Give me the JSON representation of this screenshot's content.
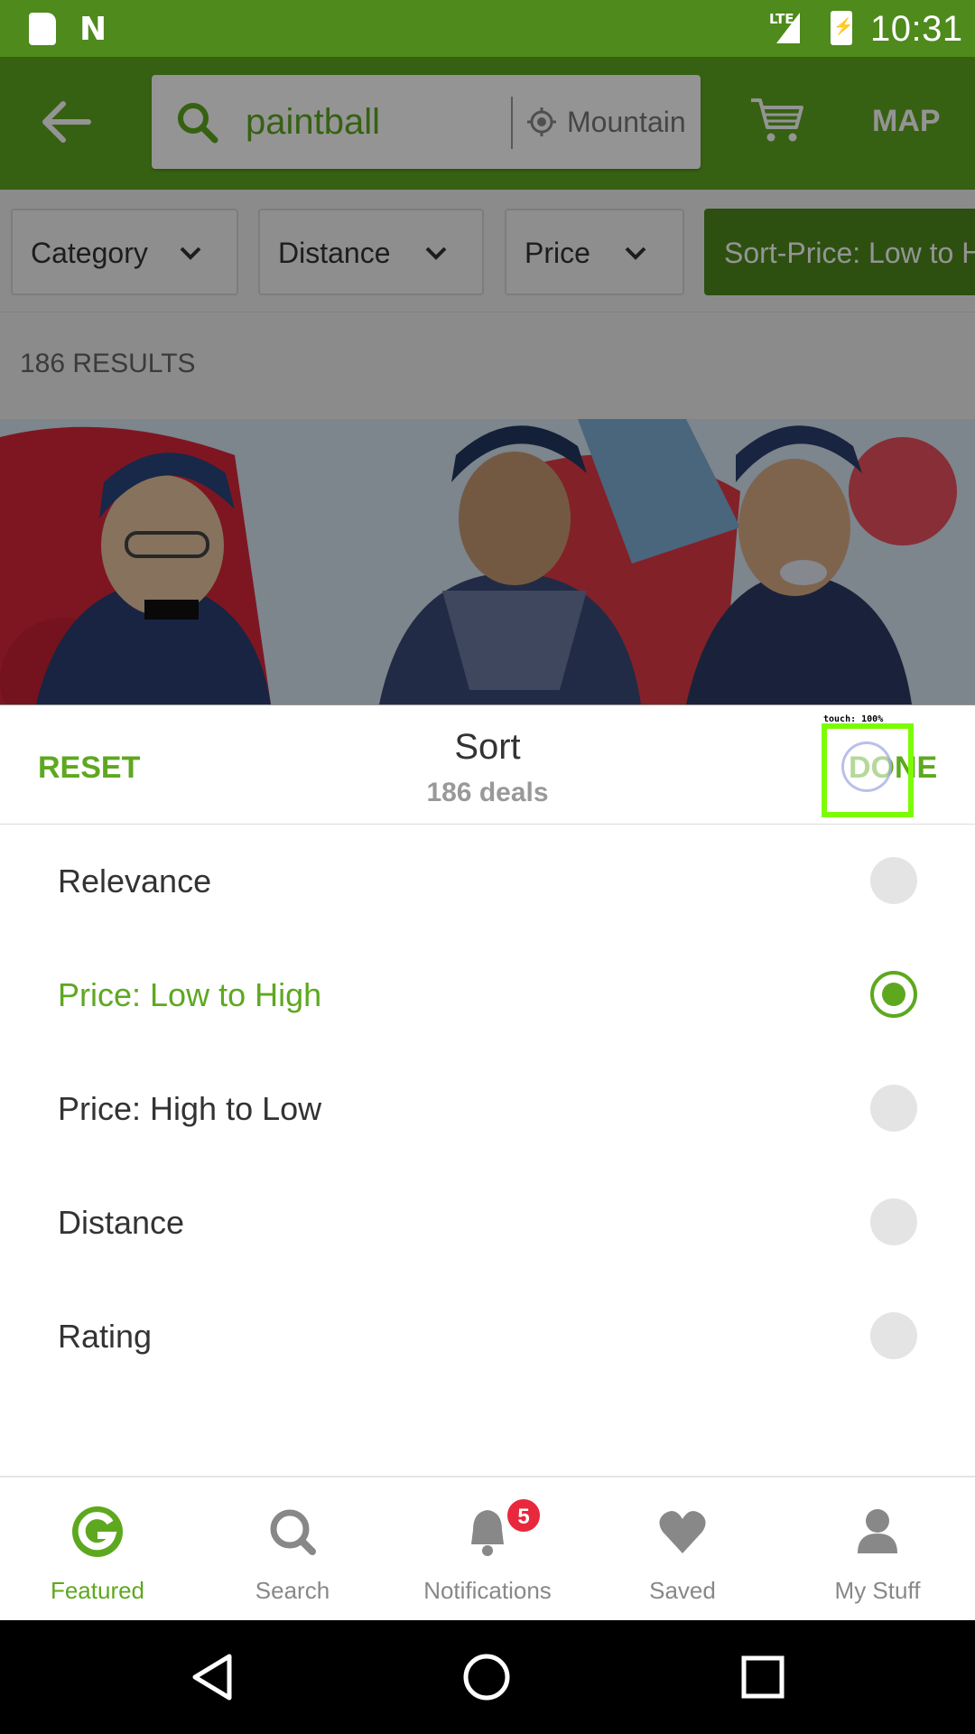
{
  "status_bar": {
    "time": "10:31",
    "network": "LTE",
    "icons": [
      "sd-card-icon",
      "n-notification-icon",
      "signal-icon",
      "battery-charging-icon"
    ]
  },
  "app_bar": {
    "search_term": "paintball",
    "location": "Mountain View",
    "map_label": "MAP",
    "icons": [
      "back-arrow-icon",
      "search-icon",
      "location-target-icon",
      "cart-icon"
    ]
  },
  "filters": [
    {
      "label": "Category"
    },
    {
      "label": "Distance"
    },
    {
      "label": "Price"
    },
    {
      "label": "Sort-Price: Low to High"
    }
  ],
  "results_label": "186 RESULTS",
  "sort_sheet": {
    "reset_label": "RESET",
    "title": "Sort",
    "subtitle": "186 deals",
    "done_label": "DONE",
    "touch_label": "touch: 100%",
    "selected": "Price: Low to High",
    "options": [
      {
        "label": "Relevance"
      },
      {
        "label": "Price: Low to High"
      },
      {
        "label": "Price: High to Low"
      },
      {
        "label": "Distance"
      },
      {
        "label": "Rating"
      }
    ]
  },
  "bottom_nav": {
    "items": [
      {
        "label": "Featured",
        "icon": "groupon-g-icon"
      },
      {
        "label": "Search",
        "icon": "search-icon"
      },
      {
        "label": "Notifications",
        "icon": "bell-icon",
        "badge": "5"
      },
      {
        "label": "Saved",
        "icon": "heart-icon"
      },
      {
        "label": "My Stuff",
        "icon": "person-icon"
      }
    ]
  },
  "colors": {
    "brand_green": "#5ea81f",
    "status_green": "#4e8a1c",
    "badge_red": "#e8283c"
  }
}
